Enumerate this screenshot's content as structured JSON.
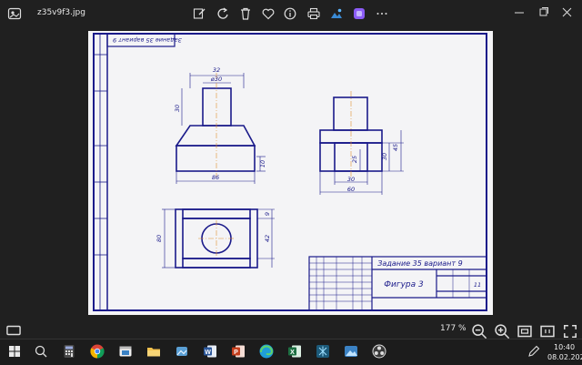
{
  "window": {
    "filename": "z35v9f3.jpg"
  },
  "toolbar": {
    "icons": [
      "edit-icon",
      "rotate-icon",
      "delete-icon",
      "favorite-icon",
      "info-icon",
      "print-icon",
      "edit-image-icon",
      "clipchamp-icon",
      "more-icon"
    ]
  },
  "drawing": {
    "stamp_top": "Задание 35 вариант 9",
    "title_task": "Задание 35 вариант 9",
    "title_figure": "Фигура 3",
    "sheet_number": "11",
    "dims": {
      "d32": "32",
      "d_phi30": "ø30",
      "d30a": "30",
      "d10": "10",
      "d86": "86",
      "d45": "45",
      "d30b": "30",
      "d25": "25",
      "d30c": "30",
      "d60": "60",
      "d80": "80",
      "d42": "42",
      "d9": "9"
    }
  },
  "status": {
    "zoom": "177 %"
  },
  "clock": {
    "time": "10:40",
    "date": "08.02.2025"
  }
}
